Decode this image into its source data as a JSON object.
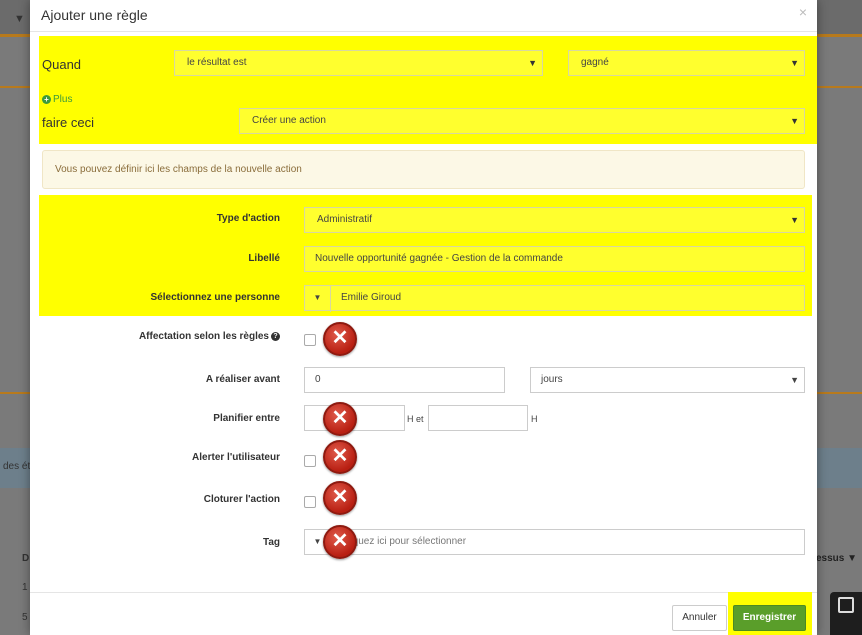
{
  "background": {
    "filter_icon": "filter-icon",
    "left_text": "des ét",
    "col_header": "D",
    "row_1": "1",
    "row_2": "5",
    "sort_label": "essus ▼"
  },
  "modal": {
    "title": "Ajouter une règle",
    "close": "×",
    "when_label": "Quand",
    "when_condition": "le résultat est",
    "when_value": "gagné",
    "plus_label": "Plus",
    "do_label": "faire ceci",
    "do_action": "Créer une action",
    "info": "Vous pouvez définir ici les champs de la nouvelle action",
    "fields": {
      "type_label": "Type d'action",
      "type_value": "Administratif",
      "libelle_label": "Libellé",
      "libelle_value": "Nouvelle opportunité gagnée - Gestion de la commande",
      "person_label": "Sélectionnez une personne",
      "person_value": "Emilie Giroud",
      "affect_label": "Affectation selon les règles",
      "realise_label": "A réaliser avant",
      "realise_value": "0",
      "realise_unit": "jours",
      "plan_label": "Planifier entre",
      "plan_h_et": "H et",
      "plan_h": "H",
      "alert_label": "Alerter l'utilisateur",
      "close_label": "Cloturer l'action",
      "tag_label": "Tag",
      "tag_placeholder": "Cliquez ici pour sélectionner"
    },
    "buttons": {
      "cancel": "Annuler",
      "save": "Enregistrer"
    }
  },
  "colors": {
    "highlight": "#ffff00",
    "save": "#5a9e2a",
    "error_marker": "#c0281a",
    "accent_bar": "#b87a1c"
  },
  "icons": [
    "filter-icon",
    "close-icon",
    "plus-circle-icon",
    "dropdown-arrow-icon",
    "help-icon",
    "error-x-icon",
    "calendar-icon"
  ]
}
